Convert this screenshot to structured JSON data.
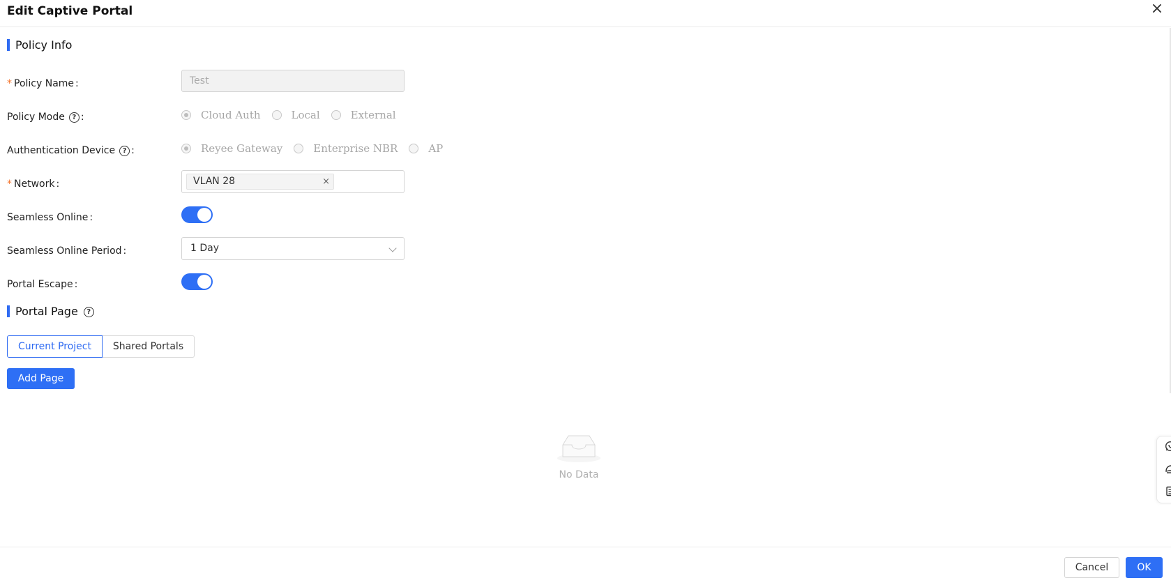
{
  "dialog": {
    "title": "Edit Captive Portal",
    "close_glyph": "×"
  },
  "sections": {
    "policy_info": "Policy Info",
    "portal_page": "Portal Page"
  },
  "form": {
    "policy_name": {
      "label": "Policy Name",
      "value": "Test",
      "required": true,
      "disabled": true
    },
    "policy_mode": {
      "label": "Policy Mode",
      "options": [
        "Cloud Auth",
        "Local",
        "External"
      ],
      "selected": "Cloud Auth",
      "disabled": true
    },
    "auth_device": {
      "label": "Authentication Device",
      "options": [
        "Reyee Gateway",
        "Enterprise NBR",
        "AP"
      ],
      "selected": "Reyee Gateway",
      "disabled": true
    },
    "network": {
      "label": "Network",
      "required": true,
      "tags": [
        "VLAN 28"
      ]
    },
    "seamless_online": {
      "label": "Seamless Online",
      "on": true
    },
    "seamless_period": {
      "label": "Seamless Online Period",
      "value": "1 Day"
    },
    "portal_escape": {
      "label": "Portal Escape",
      "on": true
    }
  },
  "portal_tabs": {
    "items": [
      "Current Project",
      "Shared Portals"
    ],
    "active": "Current Project"
  },
  "buttons": {
    "add_page": "Add Page",
    "cancel": "Cancel",
    "ok": "OK"
  },
  "empty_state": {
    "text": "No Data"
  },
  "icons": {
    "close": "close-icon",
    "help": "question-circle-icon",
    "tag_close": "close-icon",
    "dropdown": "chevron-down-icon",
    "empty": "empty-inbox-icon",
    "float": [
      "whatsapp-icon",
      "feedback-icon",
      "clipboard-icon"
    ]
  },
  "colors": {
    "primary": "#2e6ff5",
    "required_mark": "#f5732a",
    "section_bar": "#2f6bf2"
  }
}
